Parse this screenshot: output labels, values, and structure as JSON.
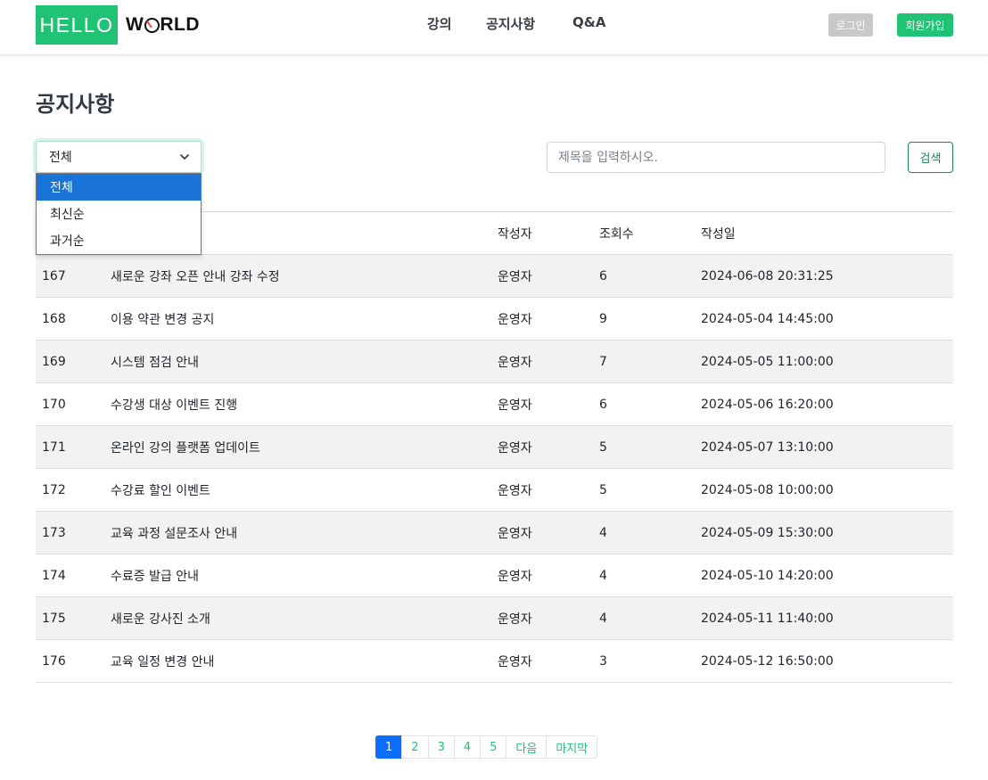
{
  "header": {
    "logo_hello": "HELLO",
    "logo_world_pre": "W",
    "logo_world_post": "RLD",
    "nav": [
      "강의",
      "공지사항",
      "Q&A"
    ],
    "login_label": "로그인",
    "signup_label": "회원가입"
  },
  "page": {
    "title": "공지사항"
  },
  "filter": {
    "selected": "전체",
    "options": [
      "전체",
      "최신순",
      "과거순"
    ]
  },
  "search": {
    "placeholder": "제목을 입력하시오.",
    "button_label": "검색"
  },
  "table": {
    "columns": [
      "",
      "",
      "작성자",
      "조회수",
      "작성일"
    ],
    "rows": [
      {
        "no": "167",
        "title": "새로운 강좌 오픈 안내 강좌 수정",
        "author": "운영자",
        "views": "6",
        "date": "2024-06-08 20:31:25"
      },
      {
        "no": "168",
        "title": "이용 약관 변경 공지",
        "author": "운영자",
        "views": "9",
        "date": "2024-05-04 14:45:00"
      },
      {
        "no": "169",
        "title": "시스템 점검 안내",
        "author": "운영자",
        "views": "7",
        "date": "2024-05-05 11:00:00"
      },
      {
        "no": "170",
        "title": "수강생 대상 이벤트 진행",
        "author": "운영자",
        "views": "6",
        "date": "2024-05-06 16:20:00"
      },
      {
        "no": "171",
        "title": "온라인 강의 플랫폼 업데이트",
        "author": "운영자",
        "views": "5",
        "date": "2024-05-07 13:10:00"
      },
      {
        "no": "172",
        "title": "수강료 할인 이벤트",
        "author": "운영자",
        "views": "5",
        "date": "2024-05-08 10:00:00"
      },
      {
        "no": "173",
        "title": "교육 과정 설문조사 안내",
        "author": "운영자",
        "views": "4",
        "date": "2024-05-09 15:30:00"
      },
      {
        "no": "174",
        "title": "수료증 발급 안내",
        "author": "운영자",
        "views": "4",
        "date": "2024-05-10 14:20:00"
      },
      {
        "no": "175",
        "title": "새로운 강사진 소개",
        "author": "운영자",
        "views": "4",
        "date": "2024-05-11 11:40:00"
      },
      {
        "no": "176",
        "title": "교육 일정 변경 안내",
        "author": "운영자",
        "views": "3",
        "date": "2024-05-12 16:50:00"
      }
    ]
  },
  "pagination": {
    "pages": [
      "1",
      "2",
      "3",
      "4",
      "5"
    ],
    "active": "1",
    "next_label": "다음",
    "last_label": "마지막"
  },
  "colors": {
    "brand_green": "#20c274",
    "active_blue": "#0d6efd",
    "dropdown_highlight": "#1a73d6"
  }
}
